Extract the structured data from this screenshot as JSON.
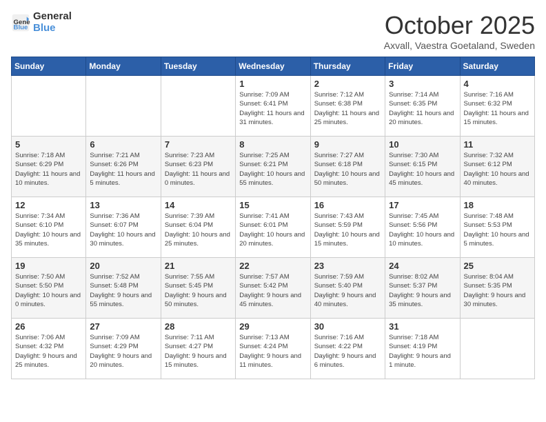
{
  "header": {
    "logo_general": "General",
    "logo_blue": "Blue",
    "month_title": "October 2025",
    "location": "Axvall, Vaestra Goetaland, Sweden"
  },
  "weekdays": [
    "Sunday",
    "Monday",
    "Tuesday",
    "Wednesday",
    "Thursday",
    "Friday",
    "Saturday"
  ],
  "weeks": [
    [
      {
        "day": "",
        "info": ""
      },
      {
        "day": "",
        "info": ""
      },
      {
        "day": "",
        "info": ""
      },
      {
        "day": "1",
        "info": "Sunrise: 7:09 AM\nSunset: 6:41 PM\nDaylight: 11 hours\nand 31 minutes."
      },
      {
        "day": "2",
        "info": "Sunrise: 7:12 AM\nSunset: 6:38 PM\nDaylight: 11 hours\nand 25 minutes."
      },
      {
        "day": "3",
        "info": "Sunrise: 7:14 AM\nSunset: 6:35 PM\nDaylight: 11 hours\nand 20 minutes."
      },
      {
        "day": "4",
        "info": "Sunrise: 7:16 AM\nSunset: 6:32 PM\nDaylight: 11 hours\nand 15 minutes."
      }
    ],
    [
      {
        "day": "5",
        "info": "Sunrise: 7:18 AM\nSunset: 6:29 PM\nDaylight: 11 hours\nand 10 minutes."
      },
      {
        "day": "6",
        "info": "Sunrise: 7:21 AM\nSunset: 6:26 PM\nDaylight: 11 hours\nand 5 minutes."
      },
      {
        "day": "7",
        "info": "Sunrise: 7:23 AM\nSunset: 6:23 PM\nDaylight: 11 hours\nand 0 minutes."
      },
      {
        "day": "8",
        "info": "Sunrise: 7:25 AM\nSunset: 6:21 PM\nDaylight: 10 hours\nand 55 minutes."
      },
      {
        "day": "9",
        "info": "Sunrise: 7:27 AM\nSunset: 6:18 PM\nDaylight: 10 hours\nand 50 minutes."
      },
      {
        "day": "10",
        "info": "Sunrise: 7:30 AM\nSunset: 6:15 PM\nDaylight: 10 hours\nand 45 minutes."
      },
      {
        "day": "11",
        "info": "Sunrise: 7:32 AM\nSunset: 6:12 PM\nDaylight: 10 hours\nand 40 minutes."
      }
    ],
    [
      {
        "day": "12",
        "info": "Sunrise: 7:34 AM\nSunset: 6:10 PM\nDaylight: 10 hours\nand 35 minutes."
      },
      {
        "day": "13",
        "info": "Sunrise: 7:36 AM\nSunset: 6:07 PM\nDaylight: 10 hours\nand 30 minutes."
      },
      {
        "day": "14",
        "info": "Sunrise: 7:39 AM\nSunset: 6:04 PM\nDaylight: 10 hours\nand 25 minutes."
      },
      {
        "day": "15",
        "info": "Sunrise: 7:41 AM\nSunset: 6:01 PM\nDaylight: 10 hours\nand 20 minutes."
      },
      {
        "day": "16",
        "info": "Sunrise: 7:43 AM\nSunset: 5:59 PM\nDaylight: 10 hours\nand 15 minutes."
      },
      {
        "day": "17",
        "info": "Sunrise: 7:45 AM\nSunset: 5:56 PM\nDaylight: 10 hours\nand 10 minutes."
      },
      {
        "day": "18",
        "info": "Sunrise: 7:48 AM\nSunset: 5:53 PM\nDaylight: 10 hours\nand 5 minutes."
      }
    ],
    [
      {
        "day": "19",
        "info": "Sunrise: 7:50 AM\nSunset: 5:50 PM\nDaylight: 10 hours\nand 0 minutes."
      },
      {
        "day": "20",
        "info": "Sunrise: 7:52 AM\nSunset: 5:48 PM\nDaylight: 9 hours\nand 55 minutes."
      },
      {
        "day": "21",
        "info": "Sunrise: 7:55 AM\nSunset: 5:45 PM\nDaylight: 9 hours\nand 50 minutes."
      },
      {
        "day": "22",
        "info": "Sunrise: 7:57 AM\nSunset: 5:42 PM\nDaylight: 9 hours\nand 45 minutes."
      },
      {
        "day": "23",
        "info": "Sunrise: 7:59 AM\nSunset: 5:40 PM\nDaylight: 9 hours\nand 40 minutes."
      },
      {
        "day": "24",
        "info": "Sunrise: 8:02 AM\nSunset: 5:37 PM\nDaylight: 9 hours\nand 35 minutes."
      },
      {
        "day": "25",
        "info": "Sunrise: 8:04 AM\nSunset: 5:35 PM\nDaylight: 9 hours\nand 30 minutes."
      }
    ],
    [
      {
        "day": "26",
        "info": "Sunrise: 7:06 AM\nSunset: 4:32 PM\nDaylight: 9 hours\nand 25 minutes."
      },
      {
        "day": "27",
        "info": "Sunrise: 7:09 AM\nSunset: 4:29 PM\nDaylight: 9 hours\nand 20 minutes."
      },
      {
        "day": "28",
        "info": "Sunrise: 7:11 AM\nSunset: 4:27 PM\nDaylight: 9 hours\nand 15 minutes."
      },
      {
        "day": "29",
        "info": "Sunrise: 7:13 AM\nSunset: 4:24 PM\nDaylight: 9 hours\nand 11 minutes."
      },
      {
        "day": "30",
        "info": "Sunrise: 7:16 AM\nSunset: 4:22 PM\nDaylight: 9 hours\nand 6 minutes."
      },
      {
        "day": "31",
        "info": "Sunrise: 7:18 AM\nSunset: 4:19 PM\nDaylight: 9 hours\nand 1 minute."
      },
      {
        "day": "",
        "info": ""
      }
    ]
  ]
}
